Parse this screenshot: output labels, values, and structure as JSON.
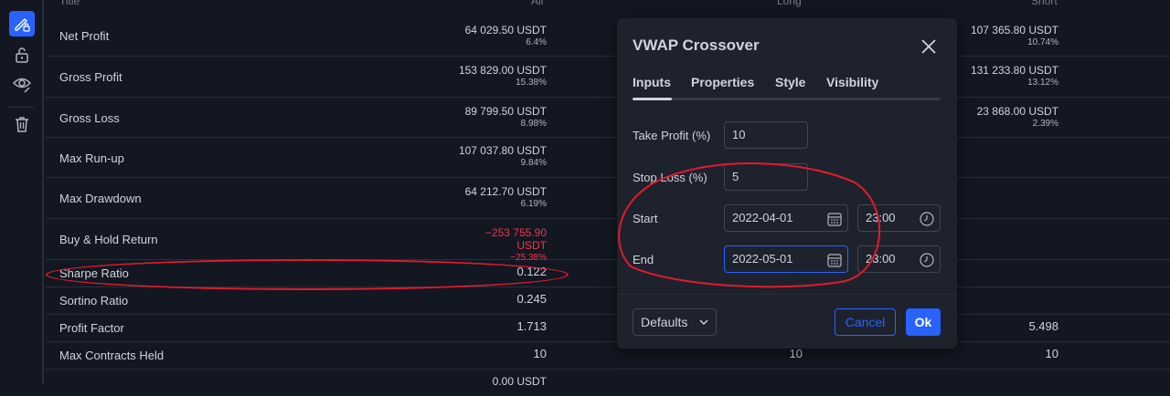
{
  "table": {
    "headers": {
      "title": "Title",
      "all": "All",
      "long": "Long",
      "short": "Short"
    },
    "rows": [
      {
        "title": "Net Profit",
        "all": "64 029.50 USDT",
        "all_pct": "6.4%",
        "short": "107 365.80 USDT",
        "short_pct": "10.74%"
      },
      {
        "title": "Gross Profit",
        "all": "153 829.00 USDT",
        "all_pct": "15.38%",
        "short": "131 233.80 USDT",
        "short_pct": "13.12%"
      },
      {
        "title": "Gross Loss",
        "all": "89 799.50 USDT",
        "all_pct": "8.98%",
        "short": "23 868.00 USDT",
        "short_pct": "2.39%"
      },
      {
        "title": "Max Run-up",
        "all": "107 037.80 USDT",
        "all_pct": "9.84%"
      },
      {
        "title": "Max Drawdown",
        "all": "64 212.70 USDT",
        "all_pct": "6.19%"
      },
      {
        "title": "Buy & Hold Return",
        "all": "−253 755.90 USDT",
        "all_pct": "−25.38%"
      },
      {
        "title": "Sharpe Ratio",
        "all": "0.122"
      },
      {
        "title": "Sortino Ratio",
        "all": "0.245"
      },
      {
        "title": "Profit Factor",
        "all": "1.713",
        "short": "5.498"
      },
      {
        "title": "Max Contracts Held",
        "all": "10",
        "long": "10",
        "short": "10"
      },
      {
        "title": "",
        "all": "0.00 USDT"
      }
    ]
  },
  "dialog": {
    "title": "VWAP Crossover",
    "tabs": [
      "Inputs",
      "Properties",
      "Style",
      "Visibility"
    ],
    "active_tab": "Inputs",
    "fields": {
      "take_profit_label": "Take Profit (%)",
      "take_profit_value": "10",
      "stop_loss_label": "Stop Loss (%)",
      "stop_loss_value": "5",
      "start_label": "Start",
      "start_date": "2022-04-01",
      "start_time": "23:00",
      "end_label": "End",
      "end_date": "2022-05-01",
      "end_time": "23:00"
    },
    "buttons": {
      "defaults": "Defaults",
      "cancel": "Cancel",
      "ok": "Ok"
    }
  },
  "colors": {
    "accent": "#2962ff",
    "negative": "#f23645",
    "annotation": "#e21b2b",
    "background": "#131722",
    "dialog": "#1e222d"
  },
  "icons": [
    "pencil-lock-icon",
    "unlock-icon",
    "eye-icon",
    "trash-icon",
    "close-icon",
    "calendar-icon",
    "clock-icon",
    "chevron-down-icon"
  ]
}
